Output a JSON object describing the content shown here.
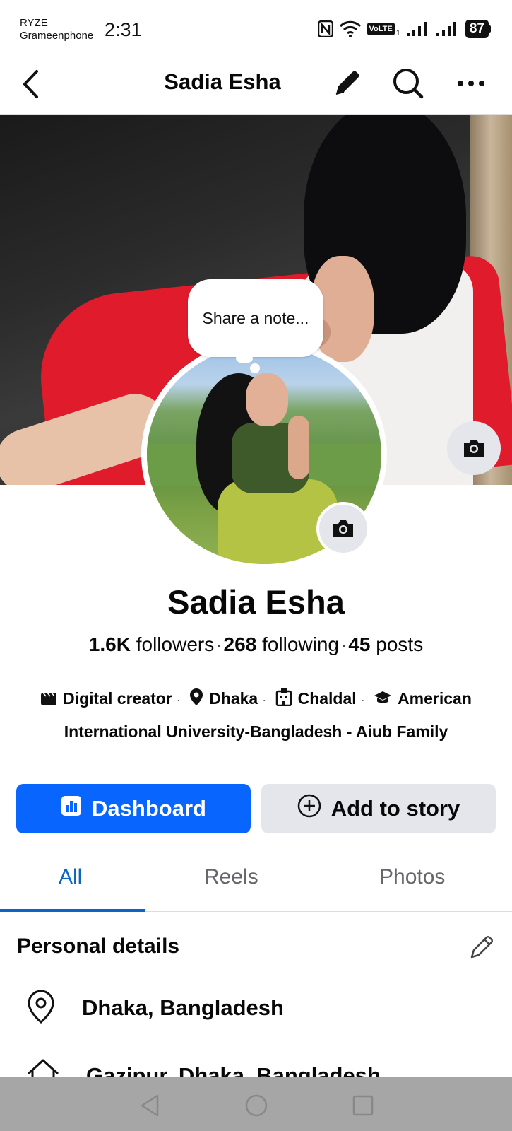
{
  "status_bar": {
    "carrier_line1": "RYZE",
    "carrier_line2": "Grameenphone",
    "time": "2:31",
    "volte": "VoLTE",
    "sim": "1",
    "battery": "87"
  },
  "header": {
    "title": "Sadia Esha",
    "icons": [
      "back-arrow-icon",
      "pencil-icon",
      "search-icon",
      "more-icon"
    ]
  },
  "note": {
    "placeholder": "Share a note..."
  },
  "profile": {
    "name": "Sadia Esha",
    "followers_count": "1.6K",
    "followers_label": "followers",
    "following_count": "268",
    "following_label": "following",
    "posts_count": "45",
    "posts_label": "posts",
    "separator": "·"
  },
  "intro": {
    "category": "Digital creator",
    "location": "Dhaka",
    "work": "Chaldal",
    "education_line1": "American",
    "education_line2": "International University-Bangladesh - Aiub Family"
  },
  "actions": {
    "dashboard": "Dashboard",
    "add_story": "Add to story",
    "primary_color": "#0866ff",
    "secondary_color": "#e4e6eb"
  },
  "tabs": [
    {
      "label": "All",
      "active": true
    },
    {
      "label": "Reels",
      "active": false
    },
    {
      "label": "Photos",
      "active": false
    }
  ],
  "personal_details": {
    "title": "Personal details",
    "items": [
      {
        "icon": "location-pin-icon",
        "text": "Dhaka, Bangladesh"
      },
      {
        "icon": "home-icon",
        "text": "Gazipur, Dhaka, Bangladesh"
      }
    ]
  },
  "nav": {
    "icons": [
      "back-triangle-icon",
      "home-circle-icon",
      "recents-square-icon"
    ]
  }
}
